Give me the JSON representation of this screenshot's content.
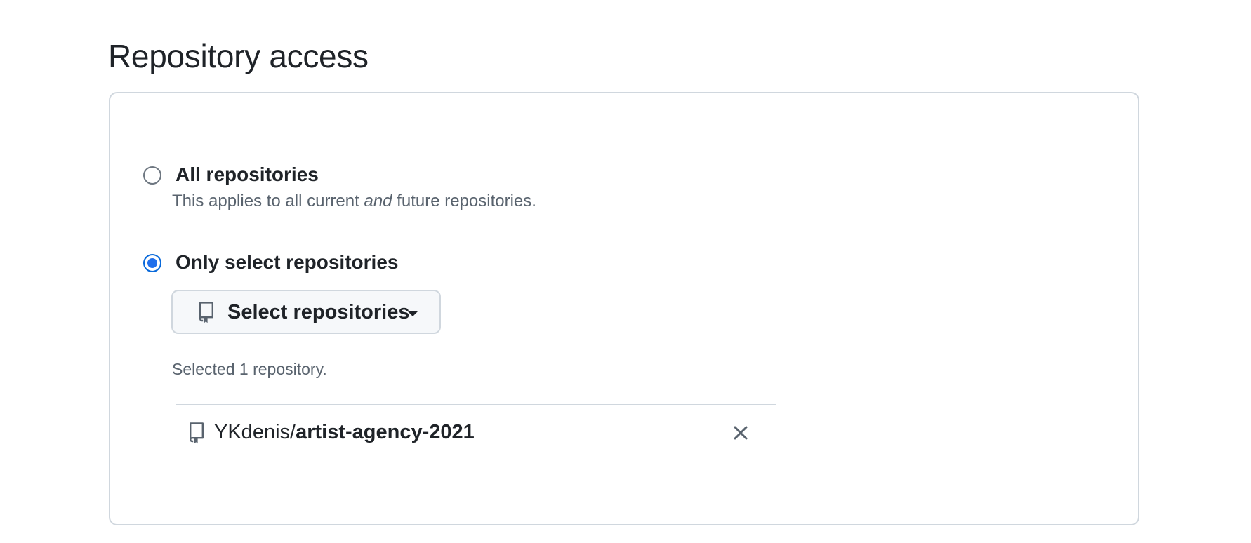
{
  "section": {
    "title": "Repository access"
  },
  "options": {
    "all": {
      "label": "All repositories",
      "desc_before": "This applies to all current ",
      "desc_emphasis": "and",
      "desc_after": " future repositories.",
      "checked": false
    },
    "select": {
      "label": "Only select repositories",
      "checked": true
    }
  },
  "select_button": {
    "label": "Select repositories",
    "icon": "repo-icon",
    "caret_icon": "caret-down-icon"
  },
  "selection": {
    "count_text": "Selected 1 repository.",
    "repos": [
      {
        "owner": "YKdenis/",
        "name": "artist-agency-2021",
        "icon": "repo-icon",
        "remove_icon": "close-icon"
      }
    ]
  },
  "colors": {
    "accent": "#1f6feb",
    "text": "#1f2328",
    "muted": "#59636e",
    "border": "#d0d7de"
  }
}
